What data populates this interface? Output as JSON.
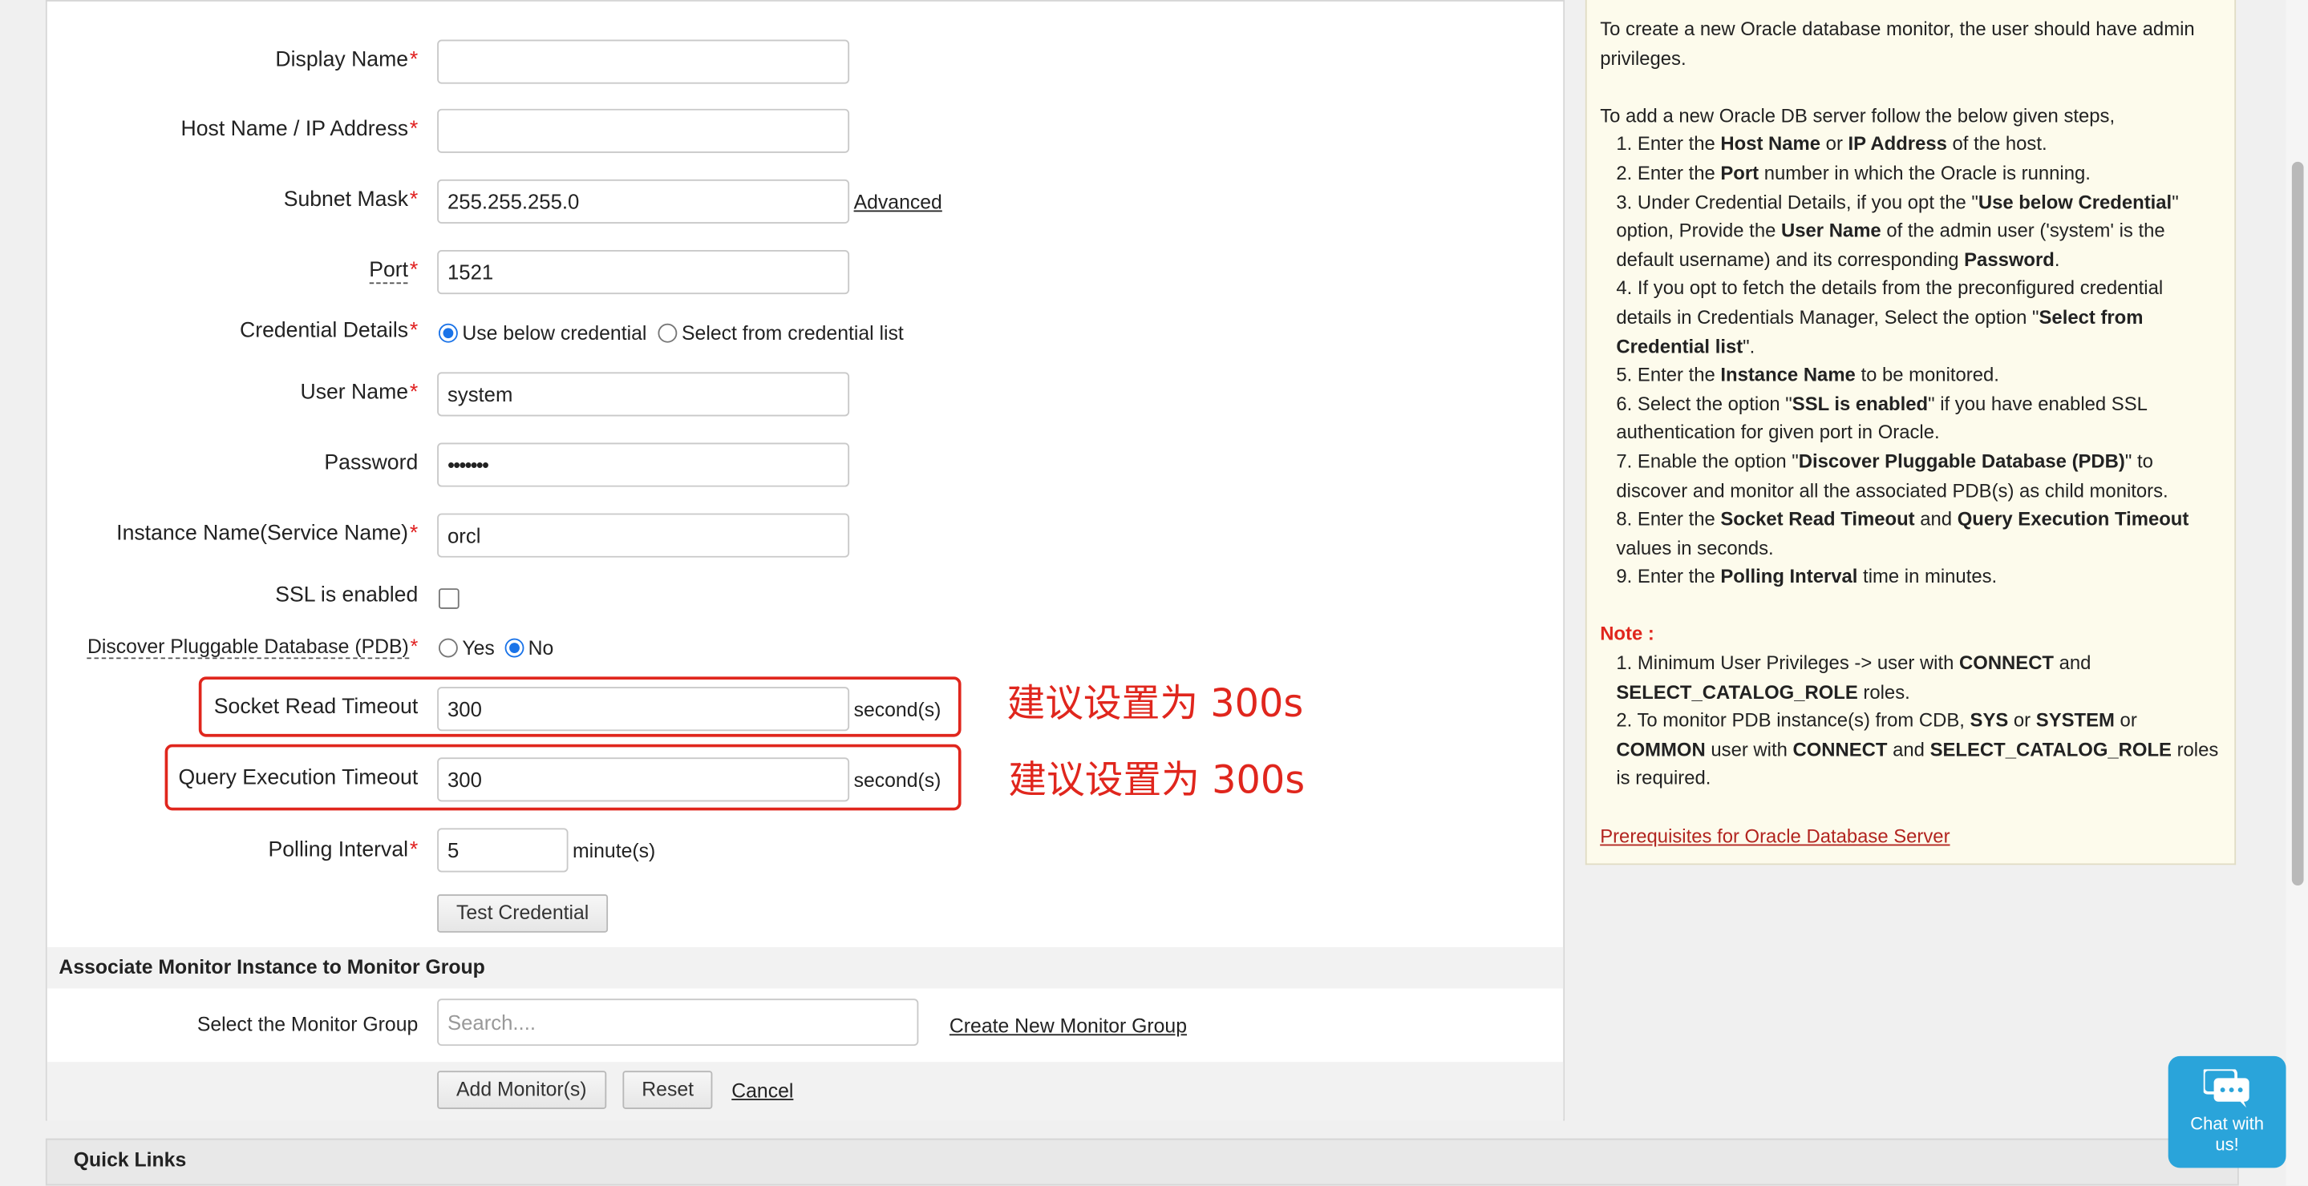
{
  "form": {
    "display_name": {
      "label": "Display Name",
      "value": ""
    },
    "host": {
      "label": "Host Name / IP Address",
      "value": ""
    },
    "subnet": {
      "label": "Subnet Mask",
      "value": "255.255.255.0",
      "advanced_link": "Advanced"
    },
    "port": {
      "label": "Port",
      "value": "1521"
    },
    "credential": {
      "label": "Credential Details",
      "option_below": "Use below credential",
      "option_list": "Select from credential list",
      "selected": "Use below credential"
    },
    "username": {
      "label": "User Name",
      "value": "system"
    },
    "password": {
      "label": "Password",
      "value": "•••••••"
    },
    "instance": {
      "label": "Instance Name(Service Name)",
      "value": "orcl"
    },
    "ssl": {
      "label": "SSL is enabled",
      "checked": false
    },
    "pdb": {
      "label": "Discover Pluggable Database (PDB)",
      "option_yes": "Yes",
      "option_no": "No",
      "selected": "No"
    },
    "socket_timeout": {
      "label": "Socket Read Timeout",
      "value": "300",
      "unit": "second(s)"
    },
    "query_timeout": {
      "label": "Query Execution Timeout",
      "value": "300",
      "unit": "second(s)"
    },
    "polling": {
      "label": "Polling Interval",
      "value": "5",
      "unit": "minute(s)"
    },
    "test_button": "Test Credential",
    "required_mark": "*"
  },
  "annotations": {
    "socket_note": "建议设置为 300s",
    "query_note": "建议设置为 300s",
    "color": "#e0261d"
  },
  "monitor_group": {
    "heading": "Associate Monitor Instance to Monitor Group",
    "label": "Select the Monitor Group",
    "placeholder": "Search....",
    "create_link": "Create New Monitor Group"
  },
  "actions": {
    "add": "Add Monitor(s)",
    "reset": "Reset",
    "cancel": "Cancel"
  },
  "help": {
    "intro": "To create a new Oracle database monitor, the user should have admin privileges.",
    "steps_heading": "To add a new Oracle DB server follow the below given steps,",
    "steps": [
      {
        "n": "1.",
        "parts": [
          "Enter the ",
          "<b>Host Name</b>",
          " or ",
          "<b>IP Address</b>",
          " of the host."
        ]
      },
      {
        "n": "2.",
        "parts": [
          "Enter the ",
          "<b>Port</b>",
          " number in which the Oracle is running."
        ]
      },
      {
        "n": "3.",
        "parts": [
          "Under Credential Details, if you opt the \"",
          "<b>Use below Credential</b>",
          "\" option, Provide the ",
          "<b>User Name</b>",
          " of the admin user ('system' is the default username) and its corresponding ",
          "<b>Password</b>",
          "."
        ]
      },
      {
        "n": "4.",
        "parts": [
          "If you opt to fetch the details from the preconfigured credential details in Credentials Manager, Select the option \"",
          "<b>Select from Credential list</b>",
          "\"."
        ]
      },
      {
        "n": "5.",
        "parts": [
          "Enter the ",
          "<b>Instance Name</b>",
          " to be monitored."
        ]
      },
      {
        "n": "6.",
        "parts": [
          "Select the option \"",
          "<b>SSL is enabled</b>",
          "\" if you have enabled SSL authentication for given port in Oracle."
        ]
      },
      {
        "n": "7.",
        "parts": [
          "Enable the option \"",
          "<b>Discover Pluggable Database (PDB)</b>",
          "\" to discover and monitor all the associated PDB(s) as child monitors."
        ]
      },
      {
        "n": "8.",
        "parts": [
          "Enter the ",
          "<b>Socket Read Timeout</b>",
          " and ",
          "<b>Query Execution Timeout</b>",
          " values in seconds."
        ]
      },
      {
        "n": "9.",
        "parts": [
          "Enter the ",
          "<b>Polling Interval</b>",
          " time in minutes."
        ]
      }
    ],
    "note_label": "Note :",
    "notes": [
      {
        "n": "1.",
        "parts": [
          "Minimum User Privileges -> user with ",
          "<b>CONNECT</b>",
          " and ",
          "<b>SELECT_CATALOG_ROLE</b>",
          " roles."
        ]
      },
      {
        "n": "2.",
        "parts": [
          "To monitor PDB instance(s) from CDB, ",
          "<b>SYS</b>",
          " or ",
          "<b>SYSTEM</b>",
          " or ",
          "<b>COMMON</b>",
          " user with ",
          "<b>CONNECT</b>",
          " and ",
          "<b>SELECT_CATALOG_ROLE</b>",
          " roles is required."
        ]
      }
    ],
    "prereq_link": "Prerequisites for Oracle Database Server"
  },
  "quick_links": "Quick Links",
  "chat": {
    "label": "Chat with us!"
  }
}
